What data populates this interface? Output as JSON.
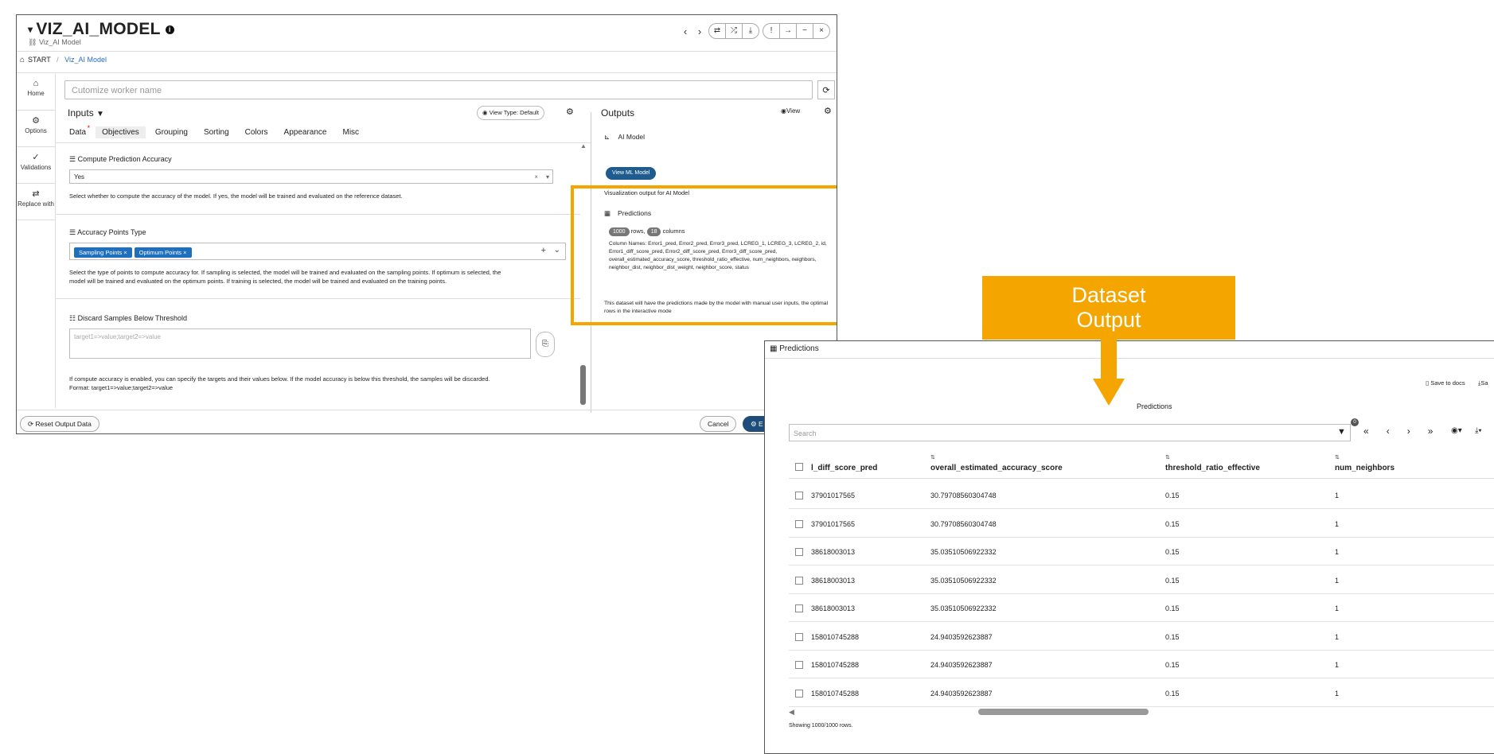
{
  "main": {
    "title": "VIZ_AI_MODEL",
    "subtitle": "Viz_AI Model",
    "breadcrumb": {
      "start": "START",
      "sep": "/",
      "current": "Viz_AI Model"
    },
    "rail": [
      {
        "label": "Home",
        "icon": "home-icon"
      },
      {
        "label": "Options",
        "icon": "gear-icon"
      },
      {
        "label": "Validations",
        "icon": "check-icon"
      },
      {
        "label": "Replace with",
        "icon": "swap-icon"
      }
    ],
    "worker_placeholder": "Cutomize worker name",
    "inputs": {
      "title": "Inputs",
      "view_type_label": "View Type: Default",
      "tabs": [
        "Data",
        "Objectives",
        "Grouping",
        "Sorting",
        "Colors",
        "Appearance",
        "Misc"
      ],
      "compute_accuracy": {
        "label": "Compute Prediction Accuracy",
        "value": "Yes",
        "help": "Select whether to compute the accuracy of the model. If yes, the model will be trained and evaluated on the reference dataset."
      },
      "accuracy_points": {
        "label": "Accuracy Points Type",
        "chips": [
          "Sampling Points",
          "Optimum Points"
        ],
        "help1": "Select the type of points to compute accuracy for. If sampling is selected, the model will be trained and evaluated on the sampling points. If optimum is selected, the",
        "help2": "model will be trained and evaluated on the optimum points. If training is selected, the model will be trained and evaluated on the training points."
      },
      "discard": {
        "label": "Discard Samples Below Threshold",
        "placeholder": "target1=>value;target2=>value",
        "help1": "If compute accuracy is enabled, you can specify the targets and their values below. If the model accuracy is below this threshold, the samples will be discarded.",
        "help2": "Format: target1=>value;target2=>value"
      }
    },
    "outputs": {
      "title": "Outputs",
      "view_label": "View",
      "ai_model_label": "AI Model",
      "view_ml_button": "View ML Model",
      "viz_text": "Visualization output for AI Model",
      "predictions_label": "Predictions",
      "rows_count": "1000",
      "rows_word": "rows,",
      "cols_count": "18",
      "cols_word": "columns",
      "column_names": "Column Names: Error1_pred, Error2_pred, Error3_pred, LCREG_1, LCREG_3, LCREG_2, id, Error1_diff_score_pred, Error2_diff_score_pred, Error3_diff_score_pred, overall_estimated_accuracy_score, threshold_ratio_effective, num_neighbors, neighbors, neighbor_dist, neighbor_dist_weight, neighbor_score, status",
      "desc": "This dataset will have the predictions made by the model with manual user inputs, the optimal rows in the interactive mode"
    },
    "footer": {
      "reset": "Reset Output Data",
      "cancel": "Cancel",
      "execute": "E"
    }
  },
  "callout": {
    "line1": "Dataset",
    "line2": "Output"
  },
  "predictions": {
    "window_title": "Predictions",
    "save_docs": "Save to docs",
    "save": "Sa",
    "center_title": "Predictions",
    "search_placeholder": "Search",
    "filter_badge": "0",
    "columns": [
      "l_diff_score_pred",
      "overall_estimated_accuracy_score",
      "threshold_ratio_effective",
      "num_neighbors"
    ],
    "rows": [
      [
        "37901017565",
        "30.79708560304748",
        "0.15",
        "1"
      ],
      [
        "37901017565",
        "30.79708560304748",
        "0.15",
        "1"
      ],
      [
        "38618003013",
        "35.03510506922332",
        "0.15",
        "1"
      ],
      [
        "38618003013",
        "35.03510506922332",
        "0.15",
        "1"
      ],
      [
        "38618003013",
        "35.03510506922332",
        "0.15",
        "1"
      ],
      [
        "158010745288",
        "24.9403592623887",
        "0.15",
        "1"
      ],
      [
        "158010745288",
        "24.9403592623887",
        "0.15",
        "1"
      ],
      [
        "158010745288",
        "24.9403592623887",
        "0.15",
        "1"
      ]
    ],
    "showing": "Showing 1000/1000 rows."
  }
}
